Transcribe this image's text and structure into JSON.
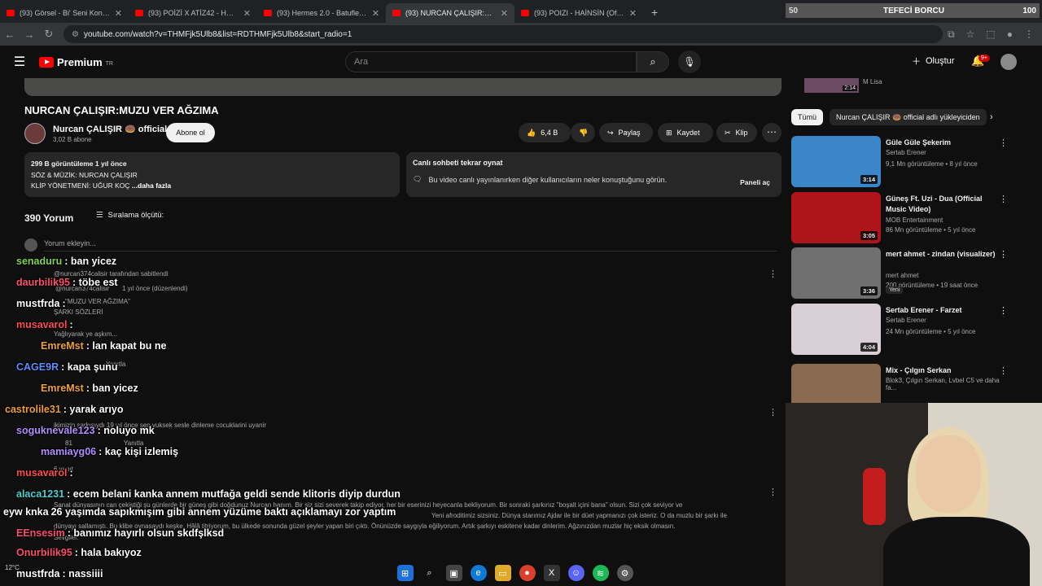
{
  "tabs": [
    {
      "label": "(93) Görsel - Bi' Seni Konusuru"
    },
    {
      "label": "(93) POİZİ X ATİZ42 - HER NERI"
    },
    {
      "label": "(93) Hermes 2.0 - Batuflex(TikTo"
    },
    {
      "label": "(93) NURCAN ÇALIŞIR:MUZU VE"
    },
    {
      "label": "(93) POIZI - HAİNSİN (Offical M"
    }
  ],
  "overlay_top": {
    "left_num": "50",
    "text": "TEFECİ BORCU",
    "right_num": "100"
  },
  "url": "youtube.com/watch?v=THMFjk5Ulb8&list=RDTHMFjk5Ulb8&start_radio=1",
  "yt": {
    "brand": "Premium",
    "region": "TR",
    "search_placeholder": "Ara",
    "create": "Oluştur",
    "notif_count": "9+"
  },
  "video": {
    "title": "NURCAN ÇALIŞIR:MUZU VER AĞZIMA",
    "channel": "Nurcan ÇALIŞIR 🍩 official",
    "subs": "3,02 B abone",
    "subscribe": "Abone ol",
    "likes": "6,4 B",
    "share": "Paylaş",
    "save": "Kaydet",
    "clip": "Klip"
  },
  "description": {
    "stats": "299 B görüntüleme  1 yıl önce",
    "line1": "SÖZ & MÜZİK: NURCAN ÇALIŞIR",
    "line2": "KLİP YÖNETMENİ: UĞUR KOÇ",
    "more": "...daha fazla"
  },
  "livechat": {
    "title": "Canlı sohbeti tekrar oynat",
    "desc": "Bu video canlı yayınlanırken diğer kullanıcıların neler konuştuğunu görün.",
    "open": "Paneli aç"
  },
  "comments": {
    "count": "390 Yorum",
    "sort": "Sıralama ölçütü:",
    "add_placeholder": "Yorum ekleyin..."
  },
  "faint_text": {
    "pinned": "@nurcan374calisir tarafından sabitlendi",
    "pin_user": "@nurcan374calisir",
    "pin_time": "1 yıl önce (düzenlendi)",
    "quote": "\"MUZU VER AĞZIMA\"",
    "lyrics": "ŞARKI SÖZLERİ",
    "line_a": "Yağlıyarak ye aşkım...",
    "reply": "Yanıtla",
    "comment2": "ikimizin şarkısıydı 19 yıl önce sen yuksek sesle dinleme cocuklarini uyanir",
    "count2": "81",
    "replies": "6 yanıt",
    "comment3a": "Sanat dünyasının can çekiştiği şu günlerde bir güneş gibi doğdunuz Nurcan hanım. Bir siz sizi severek takip ediyor, her bir eserinizi heyecanla bekliyorum. Bir sonraki şarkınız \"boşalt içini bana\" olsun. Sizi çok seviyor ve",
    "comment3b": "Yeni afroditimiz sizsiniz. Dünya starımız Ajdar ile bir düet yapmanızı çok isteriz. O da muzlu bir şarkı ile",
    "comment3c": "dünyayı sallamıştı. Bu klibe oynasaydı keşke. Hâlâ titriyorum, bu ülkede sonunda güzel şeyler yapan biri çıktı. Önünüzde saygıyla eğiliyorum. Artık şarkıyı eskitene kadar dinlerim. Ağzınızdan muzlar hiç eksik olmasın.",
    "comment3d": "Sevgiler."
  },
  "chat": [
    {
      "user": "senaduru",
      "msg": " : ban yicez",
      "color": "#7fd44b"
    },
    {
      "user": "daurbilik95",
      "msg": " : töbe est",
      "color": "#ff4d6d"
    },
    {
      "user": "mustfrda",
      "msg": " : ",
      "color": "#ffffff"
    },
    {
      "user": "musavarol",
      "msg": " : ",
      "color": "#ff4d4d"
    },
    {
      "user": "EmreMst",
      "msg": " : lan kapat bu ne",
      "color": "#f0a030"
    },
    {
      "user": "CAGE9R",
      "msg": " : kapa şunu",
      "color": "#5a8fff"
    },
    {
      "user": "EmreMst",
      "msg": " : ban yicez",
      "color": "#f0a030"
    },
    {
      "user": "castrolile31",
      "msg": " : yarak arıyo",
      "color": "#f0a030"
    },
    {
      "user": "soguknevale123",
      "msg": " : noluyo mk",
      "color": "#b48cff"
    },
    {
      "user": "mamiayg06",
      "msg": " : kaç kişi izlemiş",
      "color": "#b48cff"
    },
    {
      "user": "musavarol",
      "msg": " : ",
      "color": "#ff4d4d"
    },
    {
      "user": "alaca1231",
      "msg": " : ecem belani kanka annem mutfağa geldi sende klitoris diyip durdun",
      "color": "#4ad0d0"
    },
    {
      "user": "eyw knka",
      "msg": " 26 yaşımda sapıkmışım gibi annem yüzüme baktı açıklamayı zor yaptım",
      "color": "#ffffff"
    },
    {
      "user": "EEnsesim",
      "msg": " : banımız hayırlı olsun skdfşlksd",
      "color": "#ff4d6d"
    },
    {
      "user": "Onurbilik95",
      "msg": " : hala bakıyoz",
      "color": "#ff4d6d"
    },
    {
      "user": "mustfrda",
      "msg": " : nassiiii",
      "color": "#ffffff"
    }
  ],
  "sidebar": {
    "top_duration": "2:14",
    "top_channel": "M Lisa",
    "chips": [
      "Tümü",
      "Nurcan ÇALIŞIR 🍩 official adlı yükleyiciden"
    ],
    "recs": [
      {
        "title": "Güle Güle Şekerim",
        "channel": "Sertab Erener",
        "meta": "9,1 Mn görüntüleme • 8 yıl önce",
        "duration": "3:14",
        "color": "#3a86c8"
      },
      {
        "title": "Güneş Ft. Uzi - Dua (Official Music Video)",
        "channel": "MOB Entertainment",
        "meta": "86 Mn görüntüleme • 5 yıl önce",
        "duration": "3:05",
        "color": "#b0141b"
      },
      {
        "title": "mert ahmet - zindan (visualizer)",
        "channel": "mert ahmet",
        "meta": "200 görüntüleme • 19 saat önce",
        "duration": "3:36",
        "color": "#6f6f6f",
        "badge": "Yeni"
      },
      {
        "title": "Sertab Erener - Farzet",
        "channel": "Sertab Erener",
        "meta": "24 Mn görüntüleme • 5 yıl önce",
        "duration": "4:04",
        "color": "#d9cfd6"
      },
      {
        "title": "Mix - Çılgın Serkan",
        "channel": "Blok3, Çılgın Serkan, Lvbel C5 ve daha fa...",
        "meta": "",
        "duration": "",
        "color": "#8a6a50"
      }
    ]
  },
  "weather": "12°C"
}
